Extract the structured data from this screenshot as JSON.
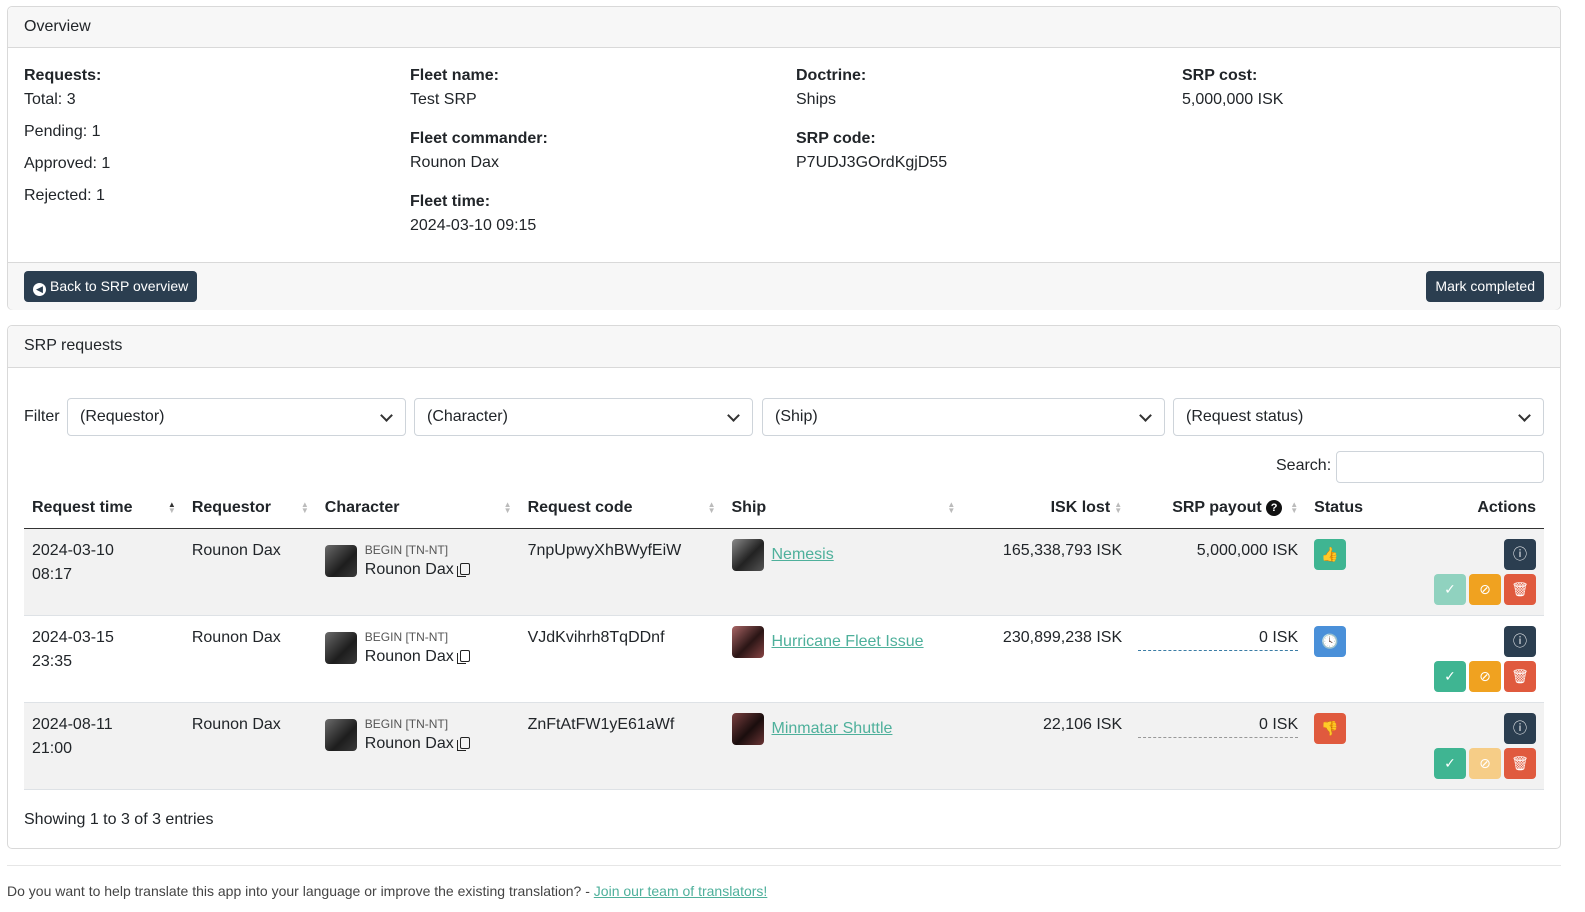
{
  "overview": {
    "header": "Overview",
    "requests": {
      "label": "Requests:",
      "total": "Total: 3",
      "pending": "Pending: 1",
      "approved": "Approved: 1",
      "rejected": "Rejected: 1"
    },
    "fleet_name": {
      "label": "Fleet name:",
      "value": "Test SRP"
    },
    "fleet_commander": {
      "label": "Fleet commander:",
      "value": "Rounon Dax"
    },
    "fleet_time": {
      "label": "Fleet time:",
      "value": "2024-03-10 09:15"
    },
    "doctrine": {
      "label": "Doctrine:",
      "value": "Ships"
    },
    "srp_code": {
      "label": "SRP code:",
      "value": "P7UDJ3GOrdKgjD55"
    },
    "srp_cost": {
      "label": "SRP cost:",
      "value": "5,000,000 ISK"
    },
    "back_button": "Back to SRP overview",
    "mark_completed_button": "Mark completed"
  },
  "requests_card": {
    "header": "SRP requests",
    "filter_label": "Filter",
    "filters": {
      "requestor": "(Requestor)",
      "character": "(Character)",
      "ship": "(Ship)",
      "status": "(Request status)"
    },
    "search_label": "Search:",
    "search_value": "",
    "columns": {
      "time": "Request time",
      "requestor": "Requestor",
      "character": "Character",
      "code": "Request code",
      "ship": "Ship",
      "isk_lost": "ISK lost",
      "payout": "SRP payout",
      "status": "Status",
      "actions": "Actions"
    },
    "rows": [
      {
        "date": "2024-03-10",
        "time": "08:17",
        "requestor": "Rounon Dax",
        "corp": "BEGIN [TN-NT]",
        "character": "Rounon Dax",
        "code": "7npUpwyXhBWyfEiW",
        "ship": "Nemesis",
        "isk_lost": "165,338,793 ISK",
        "payout": "5,000,000 ISK",
        "status": "approved",
        "status_icon": "thumbs-up-icon"
      },
      {
        "date": "2024-03-15",
        "time": "23:35",
        "requestor": "Rounon Dax",
        "corp": "BEGIN [TN-NT]",
        "character": "Rounon Dax",
        "code": "VJdKvihrh8TqDDnf",
        "ship": "Hurricane Fleet Issue",
        "isk_lost": "230,899,238 ISK",
        "payout": "0 ISK",
        "status": "pending",
        "status_icon": "clock-icon"
      },
      {
        "date": "2024-08-11",
        "time": "21:00",
        "requestor": "Rounon Dax",
        "corp": "BEGIN [TN-NT]",
        "character": "Rounon Dax",
        "code": "ZnFtAtFW1yE61aWf",
        "ship": "Minmatar Shuttle",
        "isk_lost": "22,106 ISK",
        "payout": "0 ISK",
        "status": "rejected",
        "status_icon": "thumbs-down-icon"
      }
    ],
    "showing": "Showing 1 to 3 of 3 entries"
  },
  "footer": {
    "text": "Do you want to help translate this app into your language or improve the existing translation? - ",
    "link": "Join our team of translators!"
  },
  "colors": {
    "dark": "#2b3e50",
    "success": "#3fb592",
    "warning": "#f0a220",
    "danger": "#e05a3e",
    "info": "#4a90d9",
    "link": "#4eb09b"
  }
}
